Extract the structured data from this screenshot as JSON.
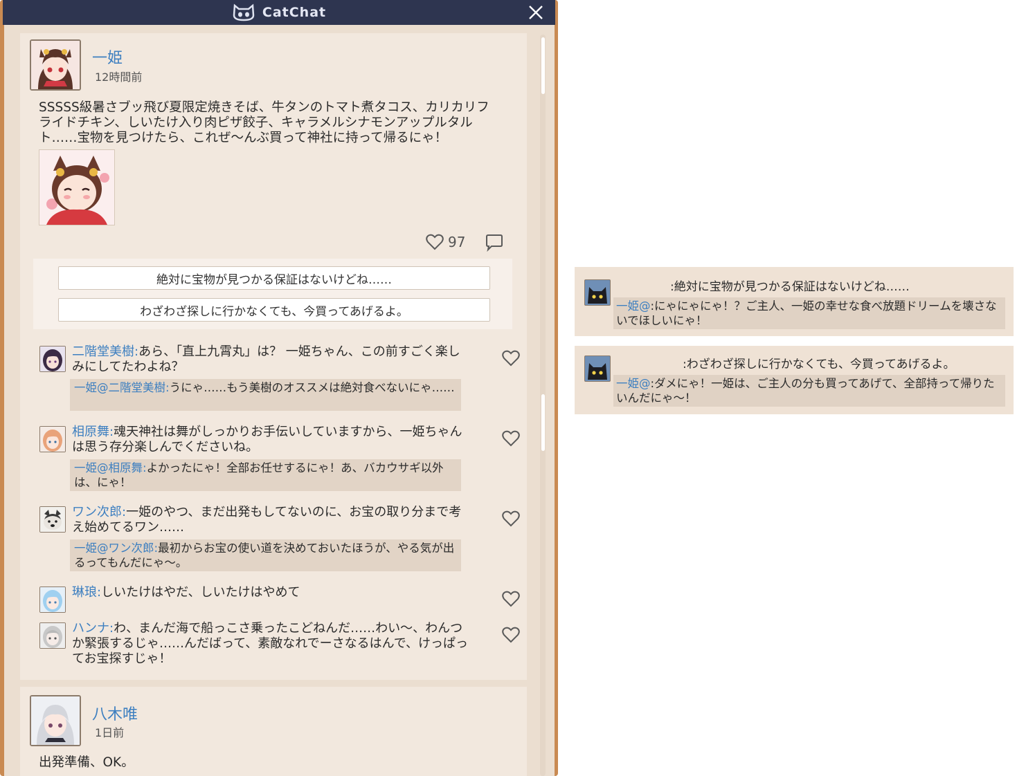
{
  "app": {
    "title": "CatChat"
  },
  "post1": {
    "author": "一姫",
    "time": "12時間前",
    "text": "SSSSS級暑さブッ飛び夏限定焼きそば、牛タンのトマト煮タコス、カリカリフライドチキン、しいたけ入り肉ピザ餃子、キャラメルシナモンアップルタルト……宝物を見つけたら、これぜ～んぶ買って神社に持って帰るにゃ！",
    "likes": "97",
    "reply_options": [
      "絶対に宝物が見つかる保証はないけどね……",
      "わざわざ探しに行かなくても、今買ってあげるよ。"
    ],
    "comments": [
      {
        "name": "二階堂美樹:",
        "text": "あら、「直上九霄丸」は？ 一姫ちゃん、この前すごく楽しみにしてたわよね？",
        "reply_name": "一姫@二階堂美樹:",
        "reply_text": "うにゃ……もう美樹のオススメは絶対食べないにゃ……"
      },
      {
        "name": "相原舞:",
        "text": "魂天神社は舞がしっかりお手伝いしていますから、一姫ちゃんは思う存分楽しんでくださいね。",
        "reply_name": "一姫@相原舞:",
        "reply_text": "よかったにゃ！全部お任せするにゃ！あ、バカウサギ以外は、にゃ！"
      },
      {
        "name": "ワン次郎:",
        "text": "一姫のやつ、まだ出発もしてないのに、お宝の取り分まで考え始めてるワン……",
        "reply_name": "一姫@ワン次郎:",
        "reply_text": "最初からお宝の使い道を決めておいたほうが、やる気が出るってもんだにゃ～。"
      },
      {
        "name": "琳琅:",
        "text": "しいたけはやだ、しいたけはやめて"
      },
      {
        "name": "ハンナ:",
        "text": "わ、まんだ海で船っこさ乗ったこどねんだ……わい～、わんつか緊張するじゃ……んだばって、素敵なれでーさなるはんで、けっぱってお宝探すじゃ！"
      }
    ]
  },
  "post2": {
    "author": "八木唯",
    "time": "1日前",
    "text": "出発準備、OK。"
  },
  "side": [
    {
      "prompt": ":絶対に宝物が見つかる保証はないけどね……",
      "reply_name": "一姫@",
      "reply_text": ":にゃにゃにゃ！？ご主人、一姫の幸せな食べ放題ドリームを壊さないでほしいにゃ！"
    },
    {
      "prompt": ":わざわざ探しに行かなくても、今買ってあげるよ。",
      "reply_name": "一姫@",
      "reply_text": ":ダメにゃ！一姫は、ご主人の分も買ってあげて、全部持って帰りたいんだにゃ～！"
    }
  ]
}
